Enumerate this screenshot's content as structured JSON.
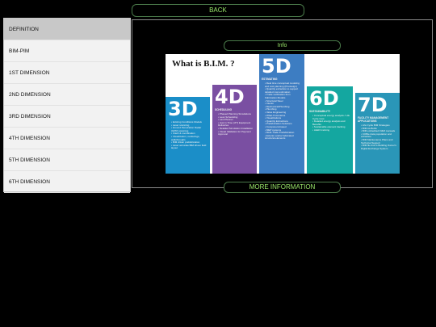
{
  "top": {
    "back_label": "BACK"
  },
  "info": {
    "label": "Info"
  },
  "more": {
    "label": "MORE INFORMATION"
  },
  "sidebar": {
    "items": [
      {
        "label": "DEFINITION",
        "active": true
      },
      {
        "label": "BIM-PIM"
      },
      {
        "label": "1ST DIMENSION"
      },
      {
        "label": "2ND DIMENSION"
      },
      {
        "label": "3RD DIMENSION"
      },
      {
        "label": "4TH DIMENSION"
      },
      {
        "label": "5TH DIMENSION"
      },
      {
        "label": "6TH DIMENSION"
      }
    ]
  },
  "infographic": {
    "title": "What is B.I.M. ?",
    "columns": [
      {
        "big": "3D",
        "sub": "",
        "items": [
          "Existing Conditions Models",
          "Laser scanning",
          "Ground Penetration Radar (GPR) scanning",
          "Clash & coordination",
          "Visualization, renderings, walkthroughs",
          "BIM driven prefabrication",
          "Laser accurate BIM driven field layout"
        ]
      },
      {
        "big": "4D",
        "sub": "SCHEDULING",
        "items": [
          "Phased Planning Simulations",
          "Lean Scheduling",
          "Last Planner",
          "Just In Time (JIT) Equipment Deliveries",
          "Detailed Simulation Installation",
          "Visual Validation for Payment Approval"
        ]
      },
      {
        "big": "5D",
        "sub": "ESTIMATING",
        "items": [
          "Real time conceptual modeling and cost planning (Predesign)",
          "Quantity extraction to support detailed cost estimation",
          "Trade verification from Fabrication Models",
          "Structural Steel",
          "Interior",
          "Mechanical/Plumbing",
          "Plumbing",
          "Value Engineering",
          "What-If scenarios",
          "Visualizations",
          "Quantity Extractions",
          "Prefabrication Solutions",
          "Component-based",
          "MEP systems",
          "Multi-Trade Prefabrication",
          "Exterior and/or fabricated structural elements"
        ]
      },
      {
        "big": "6D",
        "sub": "SUSTAINABILITY",
        "items": [
          "Conceptual energy analysis / Life Cycle Cost",
          "Detailed energy analysis and Benefits",
          "Sustainable element tracking",
          "LEED tracking"
        ]
      },
      {
        "big": "7D",
        "sub": "FACILITY MANAGEMENT APPLICATIONS",
        "items": [
          "Life Cycle BIM Strategies",
          "BIM As-Builts",
          "BIM embedded O&M manuals",
          "COBie data population and extraction",
          "BIM Maintenance Plans and Technical Support",
          "BIM file link to Building Owner's Digital Exchange System"
        ]
      }
    ]
  }
}
